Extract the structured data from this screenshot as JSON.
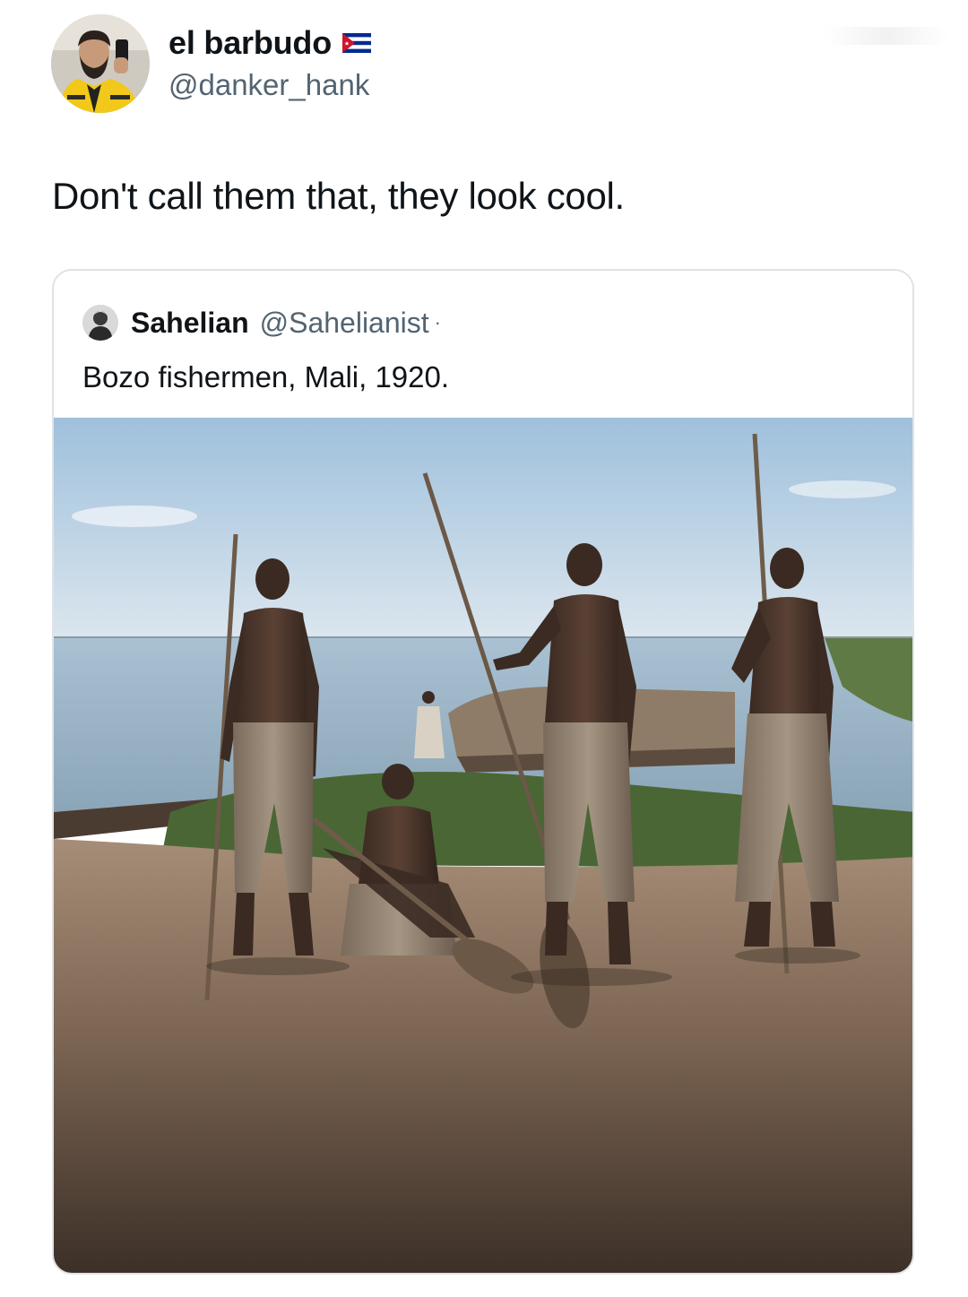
{
  "tweet": {
    "display_name": "el barbudo",
    "handle": "@danker_hank",
    "text": "Don't call them that, they look cool.",
    "flag_icon": "cuba-flag-icon"
  },
  "quoted_tweet": {
    "display_name": "Sahelian",
    "handle": "@Sahelianist",
    "separator": "·",
    "text": "Bozo fishermen, Mali, 1920."
  },
  "colors": {
    "text_primary": "#0f1419",
    "text_secondary": "#536471",
    "card_border": "#dfe3e7",
    "flag_blue": "#002a8f",
    "flag_red": "#cf142b"
  }
}
